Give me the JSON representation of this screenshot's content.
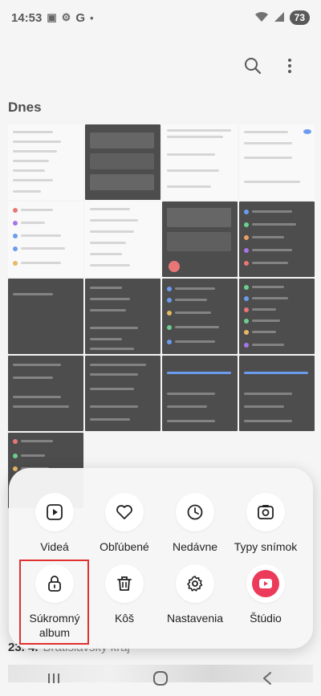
{
  "status_bar": {
    "time": "14:53",
    "carrier_letter": "G",
    "battery": "73"
  },
  "section": {
    "title": "Dnes"
  },
  "next_section": {
    "date": "23. 4.",
    "place": "Bratislavský kraj"
  },
  "menu": {
    "row1": [
      {
        "label": "Videá",
        "icon": "play-icon"
      },
      {
        "label": "Obľúbené",
        "icon": "heart-icon"
      },
      {
        "label": "Nedávne",
        "icon": "clock-icon"
      },
      {
        "label": "Typy snímok",
        "icon": "image-type-icon"
      }
    ],
    "row2": [
      {
        "label": "Súkromný album",
        "icon": "lock-icon"
      },
      {
        "label": "Kôš",
        "icon": "trash-icon"
      },
      {
        "label": "Nastavenia",
        "icon": "gear-icon"
      },
      {
        "label": "Štúdio",
        "icon": "studio-icon"
      }
    ]
  },
  "colors": {
    "highlight": "#e0302f",
    "studio": "#ec3b5a"
  }
}
